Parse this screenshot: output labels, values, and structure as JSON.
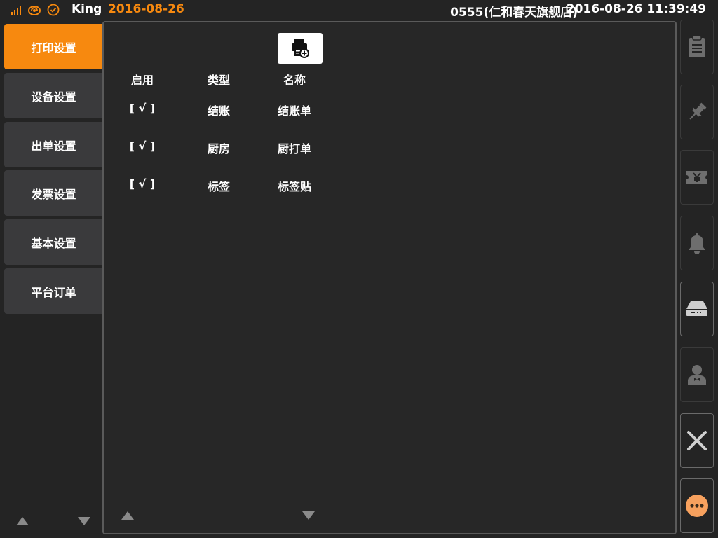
{
  "status_bar": {
    "user": "King",
    "date": "2016-08-26",
    "store": "0555(仁和春天旗舰店)",
    "datetime": "2016-08-26 11:39:49",
    "accent_color": "#f7890f",
    "icons": [
      "signal-icon",
      "sync-icon",
      "check-circle-icon"
    ]
  },
  "left_nav": {
    "items": [
      {
        "label": "打印设置",
        "active": true
      },
      {
        "label": "设备设置",
        "active": false
      },
      {
        "label": "出单设置",
        "active": false
      },
      {
        "label": "发票设置",
        "active": false
      },
      {
        "label": "基本设置",
        "active": false
      },
      {
        "label": "平台订单",
        "active": false
      }
    ]
  },
  "printer_list": {
    "add_button_icon": "printer-add-icon",
    "headers": {
      "enabled": "启用",
      "type": "类型",
      "name": "名称"
    },
    "rows": [
      {
        "enabled": "[ √ ]",
        "type": "结账",
        "name": "结账单"
      },
      {
        "enabled": "[ √ ]",
        "type": "厨房",
        "name": "厨打单"
      },
      {
        "enabled": "[ √ ]",
        "type": "标签",
        "name": "标签贴"
      }
    ]
  },
  "right_bar": {
    "buttons": [
      "clipboard-icon",
      "pin-icon",
      "ticket-yen-icon",
      "bell-icon",
      "cash-drawer-icon",
      "waiter-icon",
      "close-icon",
      "more-icon"
    ]
  }
}
